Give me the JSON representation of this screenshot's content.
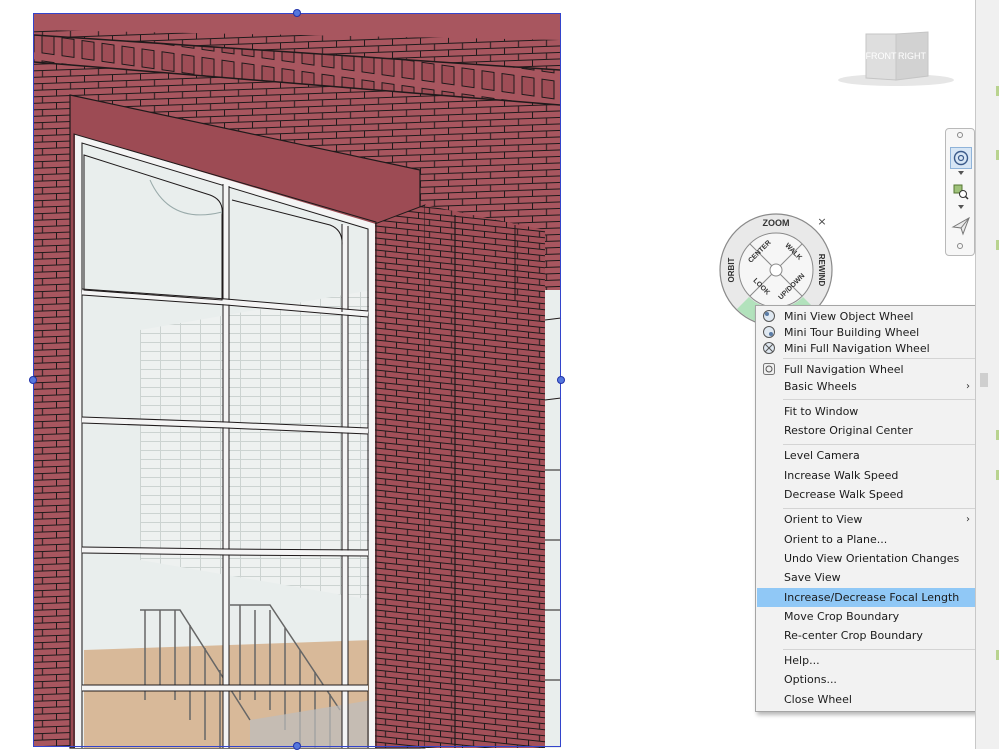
{
  "view_cube": {
    "front_label": "FRONT",
    "right_label": "RIGHT"
  },
  "wheel": {
    "zoom_label": "ZOOM",
    "rewind_label": "REWIND",
    "orbit_label": "ORBIT",
    "center_label": "CENTER",
    "walk_label": "WALK",
    "look_label": "LOOK",
    "updown_label": "UP/DOWN",
    "close_glyph": "×"
  },
  "context_menu": {
    "items": [
      {
        "label": "Mini View Object Wheel",
        "icon": "mini-view-object-wheel-icon"
      },
      {
        "label": "Mini Tour Building Wheel",
        "icon": "mini-tour-building-wheel-icon"
      },
      {
        "label": "Mini Full Navigation Wheel",
        "icon": "mini-full-navigation-wheel-icon"
      },
      {
        "label": "Full Navigation Wheel",
        "icon": "full-navigation-wheel-icon"
      },
      {
        "label": "Basic Wheels",
        "submenu": true
      },
      {
        "label": "Fit to Window"
      },
      {
        "label": "Restore Original Center"
      },
      {
        "label": "Level Camera"
      },
      {
        "label": "Increase Walk Speed"
      },
      {
        "label": "Decrease Walk Speed"
      },
      {
        "label": "Orient to View",
        "submenu": true
      },
      {
        "label": "Orient to a Plane..."
      },
      {
        "label": "Undo View Orientation Changes"
      },
      {
        "label": "Save View"
      },
      {
        "label": "Increase/Decrease Focal Length",
        "highlighted": true
      },
      {
        "label": "Move Crop Boundary"
      },
      {
        "label": "Re-center Crop Boundary"
      },
      {
        "label": "Help..."
      },
      {
        "label": "Options..."
      },
      {
        "label": "Close Wheel"
      }
    ],
    "submenu_glyph": "›"
  },
  "colors": {
    "brick": "#a8565f",
    "mortar": "#1f1a1b",
    "glass": "#e6eceb",
    "mullion": "#f5f5f5",
    "crop_boundary": "#3344cc",
    "menu_highlight": "#90c8f6",
    "menu_background": "#f2f2f2",
    "wheel_active": "#a8e0b4"
  }
}
